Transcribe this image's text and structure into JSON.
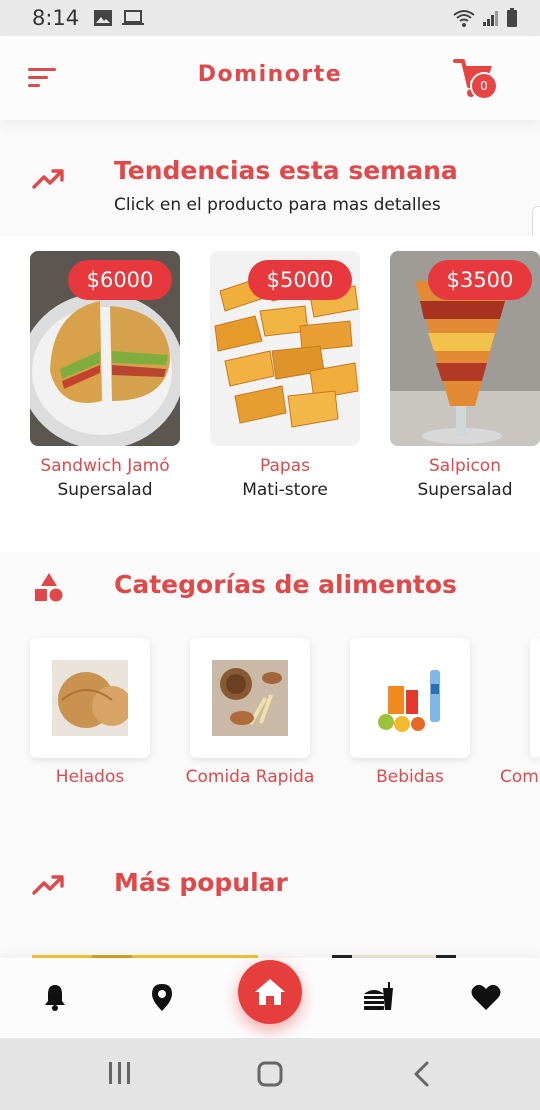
{
  "status_bar": {
    "time": "8:14",
    "left_icons": [
      "image-icon",
      "laptop-icon"
    ],
    "right_icons": [
      "wifi-icon",
      "signal-icon",
      "battery-icon"
    ]
  },
  "app_bar": {
    "title": "Dominorte",
    "cart_count": "0",
    "icons": [
      "menu-icon",
      "cart-icon"
    ]
  },
  "trending": {
    "title": "Tendencias esta semana",
    "subtitle": "Click en el producto para mas detalles",
    "icon": "trending-up-icon",
    "items": [
      {
        "price": "$6000",
        "name": "Sandwich Jamó",
        "store": "Supersalad"
      },
      {
        "price": "$5000",
        "name": "Papas",
        "store": "Mati-store"
      },
      {
        "price": "$3500",
        "name": "Salpicon",
        "store": "Supersalad"
      }
    ]
  },
  "categories": {
    "title": "Categorías de alimentos",
    "icon": "shapes-icon",
    "items": [
      {
        "label": "Helados"
      },
      {
        "label": "Comida Rapida"
      },
      {
        "label": "Bebidas"
      },
      {
        "label": "Com"
      }
    ]
  },
  "popular": {
    "title": "Más popular",
    "icon": "trending-up-icon"
  },
  "bottom_nav": {
    "items": [
      "bell-icon",
      "location-pin-icon",
      "home-icon",
      "burger-drink-icon",
      "heart-icon"
    ]
  },
  "colors": {
    "accent": "#e0484a",
    "badge": "#e7393d",
    "fab": "#e63d3d"
  }
}
